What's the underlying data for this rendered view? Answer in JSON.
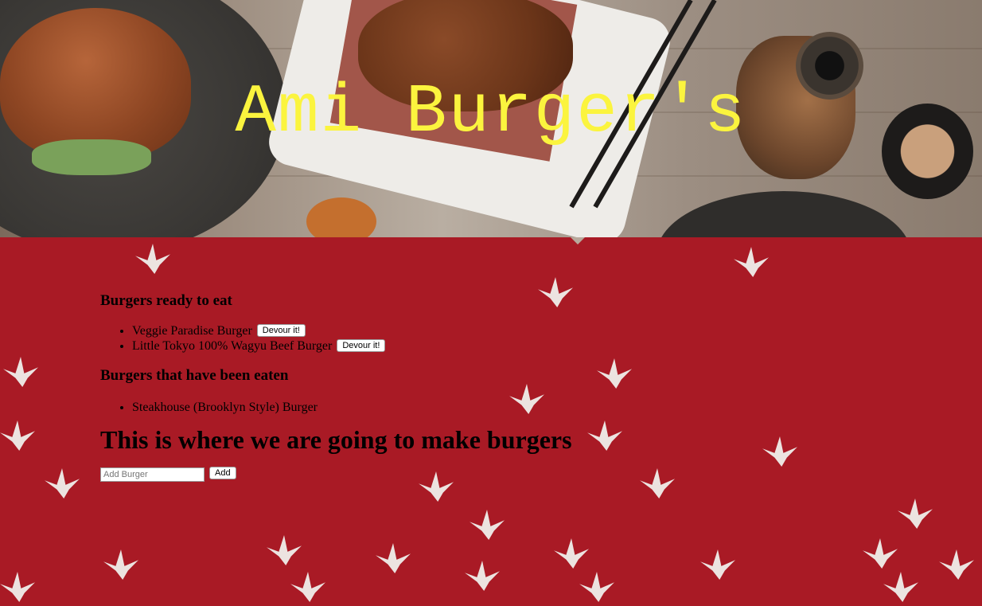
{
  "hero": {
    "title": "Ami Burger's"
  },
  "devoured_section": {
    "ready_heading": "Burgers ready to eat",
    "ready_items": [
      {
        "name": "Veggie Paradise Burger",
        "button": "Devour it!"
      },
      {
        "name": "Little Tokyo 100% Wagyu Beef Burger",
        "button": "Devour it!"
      }
    ],
    "eaten_heading": "Burgers that have been eaten",
    "eaten_items": [
      {
        "name": "Steakhouse (Brooklyn Style) Burger"
      }
    ]
  },
  "create": {
    "heading": "This is where we are going to make burgers",
    "input_placeholder": "Add Burger",
    "add_label": "Add"
  },
  "colors": {
    "background": "#a91a25",
    "title": "#fbf43e"
  }
}
